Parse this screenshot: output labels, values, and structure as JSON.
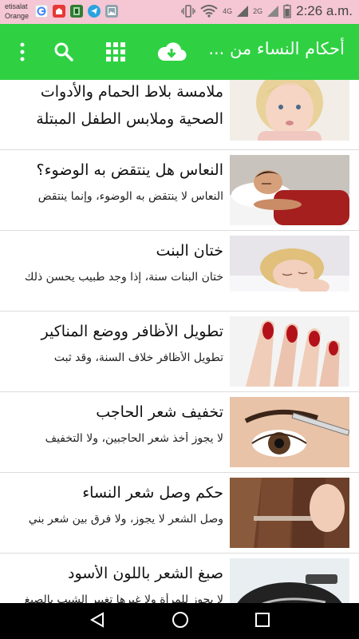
{
  "status_bar": {
    "carrier_line1": "etisalat",
    "carrier_line2": "Orange",
    "network_a": "4G",
    "network_b": "2G",
    "time": "2:26 a.m."
  },
  "app_bar": {
    "title": "أحكام النساء من ...",
    "icons": [
      "download-icon",
      "grid-icon",
      "search-icon",
      "more-icon"
    ],
    "color": "#2fd143"
  },
  "articles": [
    {
      "title": "ملامسة بلاط الحمام والأدوات الصحية وملابس الطفل المبتلة",
      "summary": "",
      "thumb": "pouting-girl"
    },
    {
      "title": "النعاس هل ينتقض به الوضوء؟",
      "summary": "النعاس لا ينتقض به الوضوء، وإنما ينتقض",
      "thumb": "sleeping-man"
    },
    {
      "title": "ختان البنت",
      "summary": "ختان البنات سنة، إذا وجد طبيب يحسن ذلك",
      "thumb": "sleeping-child"
    },
    {
      "title": "تطويل الأظافر ووضع المناكير",
      "summary": "تطويل الأظافر خلاف السنة، وقد ثبت",
      "thumb": "red-nails"
    },
    {
      "title": "تخفيف شعر الحاجب",
      "summary": "لا يجوز أخذ شعر الحاجبين، ولا التخفيف",
      "thumb": "eyebrow-tweezers"
    },
    {
      "title": "حكم وصل شعر النساء",
      "summary": "وصل الشعر لا يجوز، ولا فرق بين شعر بني",
      "thumb": "hair-extension"
    },
    {
      "title": "صبغ الشعر باللون الأسود",
      "summary": "لا يجوز للمرأة ولا غيرها تغيير الشيب بالصبغ",
      "thumb": "hair-dye"
    }
  ]
}
